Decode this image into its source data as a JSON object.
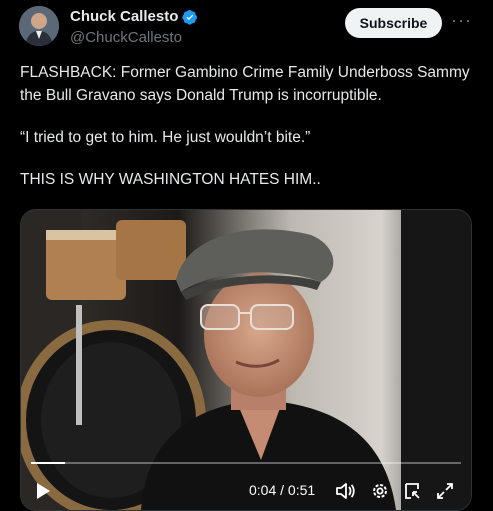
{
  "author": {
    "display_name": "Chuck Callesto",
    "handle": "@ChuckCallesto",
    "verified": true
  },
  "actions": {
    "subscribe_label": "Subscribe",
    "more_label": "···"
  },
  "tweet": {
    "line1": "FLASHBACK: Former Gambino Crime Family Underboss Sammy the Bull Gravano says Donald Trump is incorruptible.",
    "line2": "“I tried to get to him. He just wouldn’t bite.”",
    "line3": "THIS IS WHY WASHINGTON HATES HIM.."
  },
  "video": {
    "current_time": "0:04",
    "duration": "0:51",
    "time_display": "0:04 / 0:51",
    "progress_fraction": 0.08
  },
  "icons": {
    "verified": "verified-badge-icon",
    "play": "play-icon",
    "volume": "volume-icon",
    "settings": "gear-icon",
    "pip": "picture-in-picture-icon",
    "fullscreen": "fullscreen-icon"
  },
  "colors": {
    "background": "#000000",
    "text": "#e7e9ea",
    "secondary_text": "#71767b",
    "verified_blue": "#1d9bf0",
    "subscribe_bg": "#eff3f4"
  }
}
